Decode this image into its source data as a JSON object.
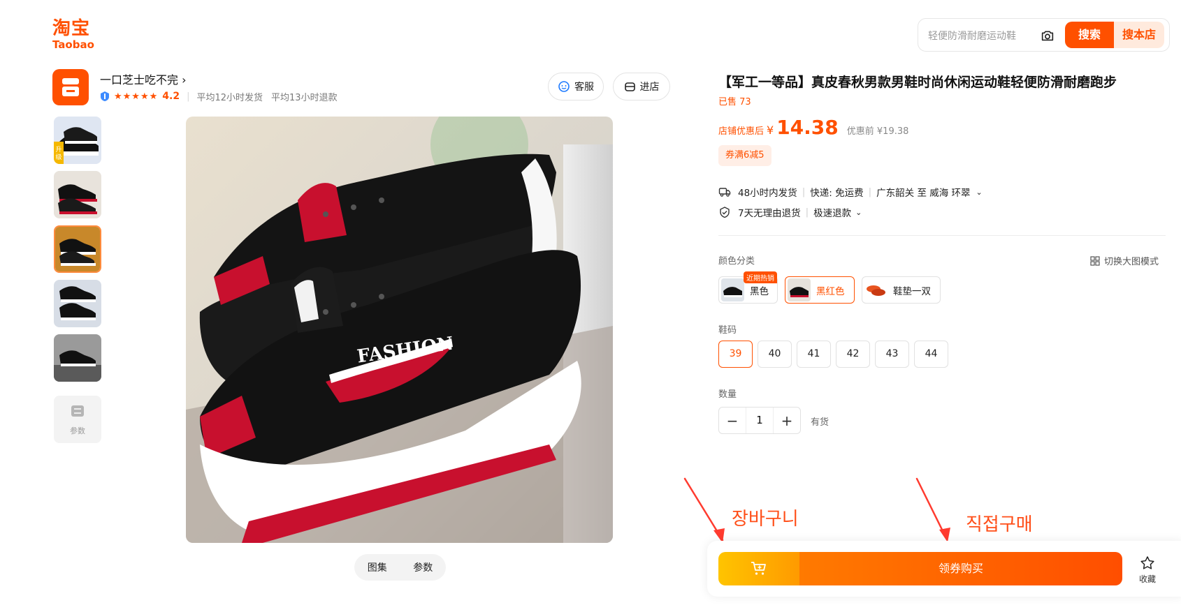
{
  "header": {
    "logo_cn": "淘宝",
    "logo_en": "Taobao",
    "search_placeholder": "轻便防滑耐磨运动鞋",
    "search_button": "搜索",
    "search_store_button": "搜本店"
  },
  "shop": {
    "name": "一口芝士吃不完",
    "rating": "4.2",
    "stars": "★★★★★",
    "ship_time": "平均12小时发货",
    "refund_time": "平均13小时退款",
    "service_button": "客服",
    "enter_store_button": "进店"
  },
  "gallery": {
    "thumbnail_1_badge": "升级版",
    "param_thumb_label": "参数",
    "tabs": [
      "图集",
      "参数"
    ]
  },
  "product": {
    "title": "【军工一等品】真皮春秋男款男鞋时尚休闲运动鞋轻便防滑耐磨跑步",
    "sold": "已售 73",
    "price_label": "店铺优惠后",
    "currency": "¥",
    "price": "14.38",
    "original_price": "优惠前 ¥19.38",
    "coupon": "券满6减5"
  },
  "services": {
    "ship": "48小时内发货",
    "shipping_fee": "快递: 免运费",
    "route": "广东韶关 至 威海 环翠",
    "returns": "7天无理由退货",
    "refund": "极速退款"
  },
  "options": {
    "color_label": "颜色分类",
    "big_image_mode": "切换大图模式",
    "colors": [
      "黑色",
      "黑红色",
      "鞋垫一双"
    ],
    "hot_tag": "近期热销",
    "selected_color": "黑红色",
    "size_label": "鞋码",
    "sizes": [
      "39",
      "40",
      "41",
      "42",
      "43",
      "44"
    ],
    "selected_size": "39",
    "quantity_label": "数量",
    "quantity": "1",
    "stock": "有货"
  },
  "actions": {
    "buy_button": "领券购买",
    "favorite": "收藏"
  },
  "annotations": {
    "cart_note": "장바구니",
    "buy_note": "직접구매"
  },
  "colors": {
    "brand": "#ff5000",
    "cart_gradient": [
      "#ffc400",
      "#ff9a00"
    ],
    "buy_gradient": [
      "#ff7a00",
      "#ff4e00"
    ]
  }
}
